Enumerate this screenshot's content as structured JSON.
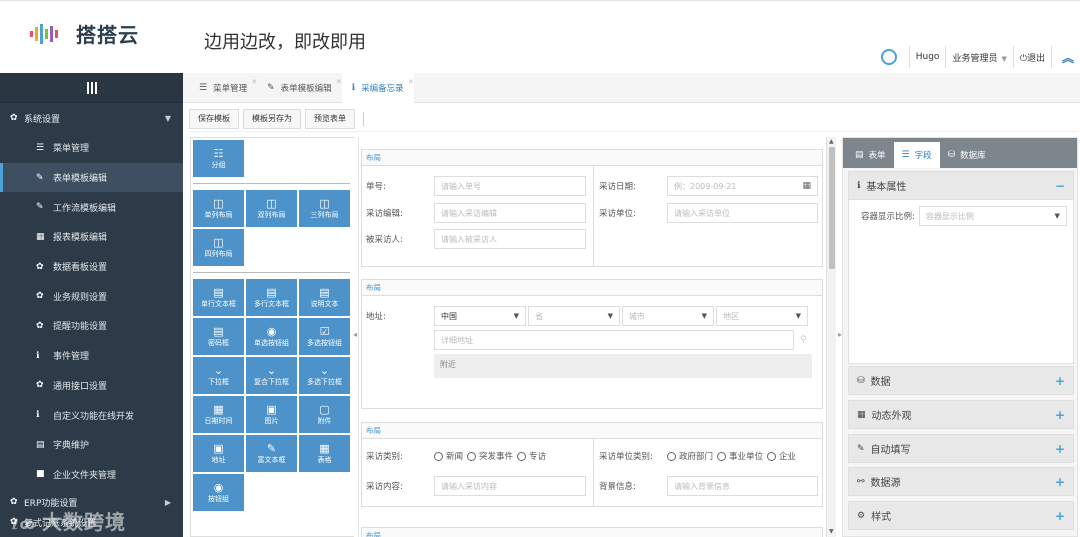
{
  "brand": {
    "name": "搭搭云",
    "slogan": "边用边改，即改即用"
  },
  "header": {
    "user": "Hugo",
    "role": "业务管理员",
    "logout": "退出",
    "gear_icon": "gear-icon",
    "collapse_icon": "chevron-up-icon"
  },
  "sidebar": {
    "group": "系统设置",
    "items": [
      {
        "label": "菜单管理",
        "icon": "list-icon"
      },
      {
        "label": "表单模板编辑",
        "icon": "edit-icon"
      },
      {
        "label": "工作流模板编辑",
        "icon": "edit-icon"
      },
      {
        "label": "报表模板编辑",
        "icon": "table-icon"
      },
      {
        "label": "数据看板设置",
        "icon": "gear-icon"
      },
      {
        "label": "业务规则设置",
        "icon": "gear-icon"
      },
      {
        "label": "提醒功能设置",
        "icon": "gear-icon"
      },
      {
        "label": "事件管理",
        "icon": "info-icon"
      },
      {
        "label": "通用接口设置",
        "icon": "gear-icon"
      },
      {
        "label": "自定义功能在线开发",
        "icon": "info-icon"
      },
      {
        "label": "字典维护",
        "icon": "keyboard-icon"
      },
      {
        "label": "企业文件夹管理",
        "icon": "folder-icon"
      }
    ],
    "group2": "ERP功能设置",
    "group3": "复式记账系统设置",
    "watermark": "大数跨境"
  },
  "tabs": [
    {
      "label": "菜单管理",
      "icon": "list-icon"
    },
    {
      "label": "表单模板编辑",
      "icon": "edit-icon"
    },
    {
      "label": "采编备忘录",
      "icon": "info-icon"
    }
  ],
  "toolbar": {
    "save": "保存模板",
    "save_as": "模板另存为",
    "preview": "预览表单"
  },
  "palette": {
    "group": "分组",
    "layouts": [
      "单列布局",
      "双列布局",
      "三列布局",
      "四列布局"
    ],
    "fields": [
      "单行文本框",
      "多行文本框",
      "说明文本",
      "密码框",
      "单选按钮组",
      "多选按钮组",
      "下拉框",
      "复合下拉框",
      "多选下拉框",
      "日期时间",
      "图片",
      "附件",
      "地址",
      "富文本框",
      "表格",
      "按钮组"
    ]
  },
  "form": {
    "section_title": "布局",
    "s1": {
      "danhao_label": "单号:",
      "danhao_ph": "请输入单号",
      "date_label": "采访日期:",
      "date_ph": "例：2009-09-21",
      "editor_label": "采访编辑:",
      "editor_ph": "请输入采访编辑",
      "unit_label": "采访单位:",
      "unit_ph": "请输入采访单位",
      "person_label": "被采访人:",
      "person_ph": "请输入被采访人"
    },
    "s2": {
      "addr_label": "地址:",
      "country": "中国",
      "province": "省",
      "city": "城市",
      "district": "地区",
      "detail_ph": "详细地址",
      "nearby": "附近"
    },
    "s3": {
      "type_label": "采访类别:",
      "types": [
        "新闻",
        "突发事件",
        "专访"
      ],
      "unit_type_label": "采访单位类别:",
      "unit_types": [
        "政府部门",
        "事业单位",
        "企业"
      ],
      "content_label": "采访内容:",
      "content_ph": "请输入采访内容",
      "bg_label": "背景信息:",
      "bg_ph": "请输入背景信息"
    }
  },
  "right_panel": {
    "tabs": [
      "表单",
      "字段",
      "数据库"
    ],
    "basic": "基本属性",
    "ratio_label": "容器显示比例:",
    "ratio_ph": "容器显示比例",
    "sections": [
      "数据",
      "动态外观",
      "自动填写",
      "数据源",
      "样式"
    ]
  },
  "colors": {
    "sidebar_bg": "#2d3b48",
    "accent": "#4d93c9",
    "link": "#2f7fc2"
  }
}
